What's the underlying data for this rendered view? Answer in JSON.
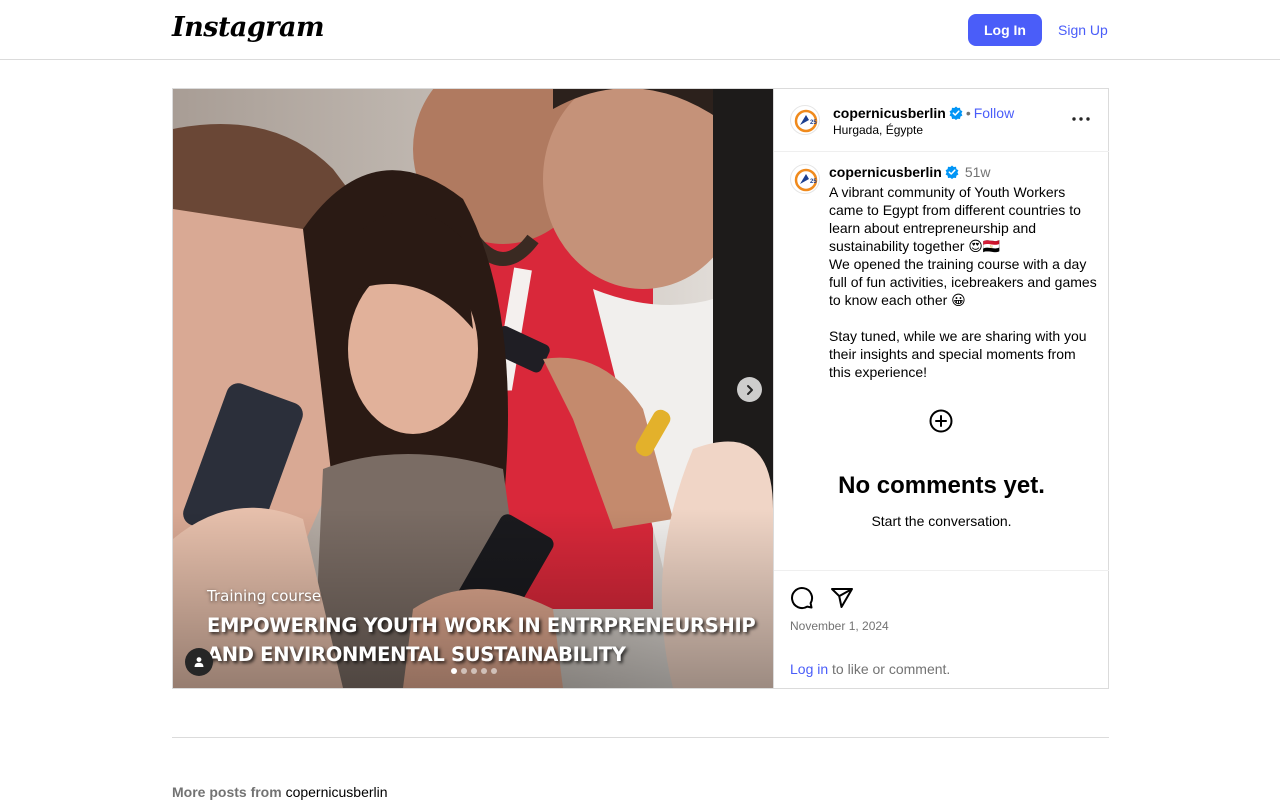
{
  "nav": {
    "logo_text": "Instagram",
    "login_label": "Log In",
    "signup_label": "Sign Up"
  },
  "post": {
    "username": "copernicusberlin",
    "follow_label": "Follow",
    "separator": "•",
    "location": "Hurgada, Égypte",
    "image": {
      "caption_small": "Training course",
      "caption_line1": "EMPOWERING YOUTH WORK IN ENTRPRENEURSHIP",
      "caption_line2": "AND ENVIRONMENTAL SUSTAINABILITY",
      "slide_count": 5,
      "active_slide": 1
    },
    "caption": {
      "username": "copernicusberlin",
      "time_ago": "51w",
      "text": "A vibrant community of Youth Workers came to Egypt from different countries to learn about entrepreneurship and sustainability together 😍🇪🇬\nWe opened the training course with a day full of fun activities, icebreakers and games to know each other 😀\n\nStay tuned, while we are sharing with you their insights and special moments from this experience!"
    },
    "no_comments_title": "No comments yet.",
    "no_comments_sub": "Start the conversation.",
    "date": "November 1, 2024",
    "login_link": "Log in",
    "login_suffix": " to like or comment."
  },
  "more_posts": {
    "label": "More posts from ",
    "username": "copernicusberlin"
  },
  "colors": {
    "accent": "#4a5df9",
    "verified": "#0095f6",
    "muted": "#737373",
    "border": "#dbdbdb"
  },
  "icons": [
    "more-icon",
    "verified-icon",
    "chevron-right-icon",
    "user-tag-icon",
    "add-circle-icon",
    "comment-icon",
    "share-icon"
  ]
}
